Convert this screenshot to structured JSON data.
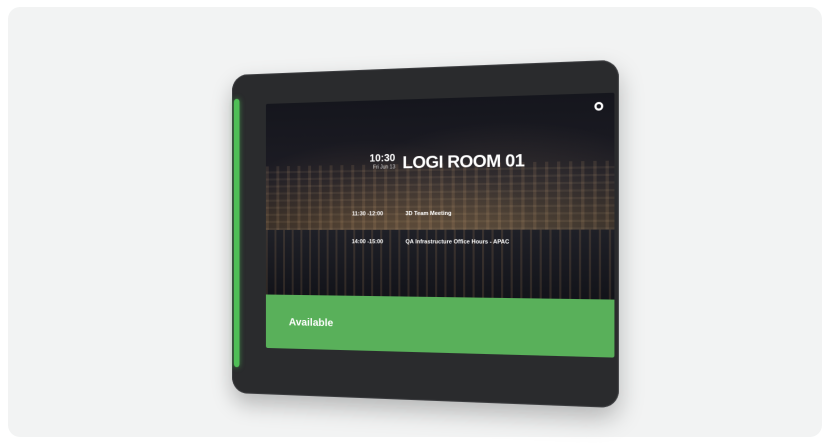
{
  "room": {
    "time": "10:30",
    "date": "Fri Jun 13",
    "name": "LOGI ROOM 01",
    "meetings": [
      {
        "time": "11:30 -12:00",
        "title": "3D Team Meeting"
      },
      {
        "time": "14:00 -15:00",
        "title": "QA Infrastructure Office Hours - APAC"
      }
    ],
    "status": "Available"
  },
  "colors": {
    "status_green": "#59b05a",
    "led_green": "#4fbf56",
    "bezel": "#2a2b2d",
    "card_background": "#f2f3f3"
  },
  "icons": {
    "settings": "settings-icon"
  }
}
